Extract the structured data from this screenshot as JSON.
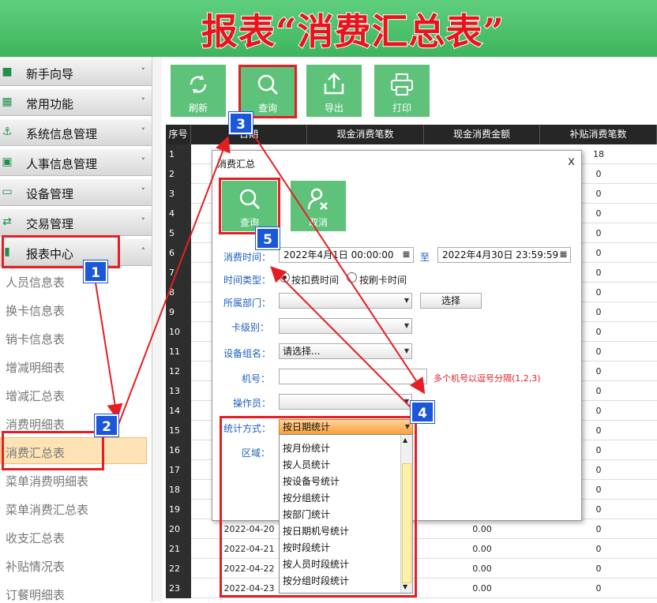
{
  "banner_title": "报表“消费汇总表”",
  "sidebar": {
    "menus": [
      {
        "label": "新手向导",
        "icon": "book-icon",
        "glyph": "■",
        "state": "collapsed"
      },
      {
        "label": "常用功能",
        "icon": "grid-icon",
        "glyph": "▦",
        "state": "collapsed"
      },
      {
        "label": "系统信息管理",
        "icon": "anchor-icon",
        "glyph": "⚓",
        "state": "collapsed"
      },
      {
        "label": "人事信息管理",
        "icon": "id-card-icon",
        "glyph": "▣",
        "state": "collapsed"
      },
      {
        "label": "设备管理",
        "icon": "monitor-icon",
        "glyph": "▭",
        "state": "collapsed"
      },
      {
        "label": "交易管理",
        "icon": "exchange-icon",
        "glyph": "⇄",
        "state": "collapsed"
      },
      {
        "label": "报表中心",
        "icon": "bar-chart-icon",
        "glyph": "▮",
        "state": "expanded"
      }
    ],
    "report_items": [
      "人员信息表",
      "换卡信息表",
      "销卡信息表",
      "增减明细表",
      "增减汇总表",
      "消费明细表",
      "消费汇总表",
      "菜单消费明细表",
      "菜单消费汇总表",
      "收支汇总表",
      "补贴情况表",
      "订餐明细表"
    ],
    "active_item": "消费汇总表",
    "collapse_glyph": "˅",
    "expand_glyph": "˄"
  },
  "toolbar": [
    {
      "label": "刷新",
      "icon": "refresh-icon"
    },
    {
      "label": "查询",
      "icon": "search-icon"
    },
    {
      "label": "导出",
      "icon": "export-icon"
    },
    {
      "label": "打印",
      "icon": "print-icon"
    }
  ],
  "grid": {
    "columns": [
      "序号",
      "日期",
      "现金消费笔数",
      "现金消费金额",
      "补贴消费笔数"
    ],
    "rows": [
      {
        "n": "1",
        "sub": "18"
      },
      {
        "n": "2",
        "sub": "0"
      },
      {
        "n": "3",
        "sub": "0"
      },
      {
        "n": "4",
        "sub": "0"
      },
      {
        "n": "5",
        "sub": "0"
      },
      {
        "n": "6",
        "sub": "0"
      },
      {
        "n": "7",
        "sub": "0"
      },
      {
        "n": "8",
        "sub": "0"
      },
      {
        "n": "9",
        "sub": "0"
      },
      {
        "n": "10",
        "sub": "0"
      },
      {
        "n": "11",
        "sub": "0"
      },
      {
        "n": "12",
        "sub": "0"
      },
      {
        "n": "13",
        "sub": "0"
      },
      {
        "n": "14",
        "sub": "0"
      },
      {
        "n": "15",
        "sub": "0"
      },
      {
        "n": "16",
        "sub": "0"
      },
      {
        "n": "17",
        "sub": "0"
      },
      {
        "n": "18",
        "sub": "0"
      },
      {
        "n": "19",
        "sub": "0"
      },
      {
        "n": "20",
        "date": "2022-04-20",
        "amt": "0.00",
        "sub": "0"
      },
      {
        "n": "21",
        "date": "2022-04-21",
        "amt": "0.00",
        "sub": "0"
      },
      {
        "n": "22",
        "date": "2022-04-22",
        "amt": "0.00",
        "sub": "0"
      },
      {
        "n": "23",
        "date": "2022-04-23",
        "amt": "0.00",
        "sub": "0"
      }
    ]
  },
  "dialog": {
    "title": "消费汇总",
    "close": "x",
    "buttons": [
      {
        "label": "查询",
        "icon": "search-icon"
      },
      {
        "label": "取消",
        "icon": "cancel-user-icon"
      }
    ],
    "time_label": "消费时间：",
    "start_time": "2022年4月1日 00:00:00",
    "to_label": "至",
    "end_time": "2022年4月30日 23:59:59",
    "time_type_label": "时间类型：",
    "time_type_options": [
      "按扣费时间",
      "按刷卡时间"
    ],
    "time_type_selected": "按扣费时间",
    "dept_label": "所属部门：",
    "dept_value": "",
    "select_button": "选择",
    "card_level_label": "卡级别：",
    "card_level_value": "",
    "device_group_label": "设备组名：",
    "device_group_value": "请选择...",
    "machine_label": "机号：",
    "machine_value": "",
    "machine_hint": "多个机号以逗号分隔(1,2,3)",
    "operator_label": "操作员：",
    "operator_value": "",
    "stat_label": "统计方式：",
    "stat_value": "按日期统计",
    "region_label": "区域：",
    "stat_options": [
      "按月份统计",
      "按人员统计",
      "按设备号统计",
      "按分组统计",
      "按部门统计",
      "按日期机号统计",
      "按时段统计",
      "按人员时段统计",
      "按分组时段统计"
    ]
  },
  "steps": [
    "1",
    "2",
    "3",
    "4",
    "5"
  ],
  "colors": {
    "accent_green": "#5ec27b",
    "banner_red": "#e8141c",
    "annotation_red": "#e61e24",
    "badge_blue": "#1c56d9",
    "active_row": "#fde3b6"
  }
}
